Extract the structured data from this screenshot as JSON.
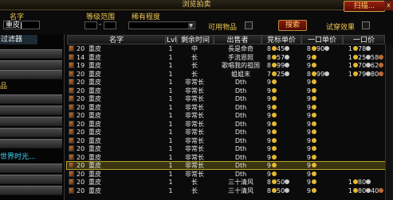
{
  "window": {
    "title": "浏览拍卖",
    "scan_button": "扫描...",
    "close": "x"
  },
  "search": {
    "name_label": "名字",
    "name_value": "重皮",
    "level_range_label": "等级范围",
    "level_sep": "-",
    "rarity_label": "稀有程度",
    "usable_label": "可用物品",
    "search_button": "搜索",
    "preview_label": "试穿效果"
  },
  "left_panel": {
    "filter_tab": "过滤器",
    "highlight_item": "品",
    "cyan_text": "世界时光..."
  },
  "columns": {
    "name": "名字",
    "lvl": "Lvl",
    "time_left": "剩余时间",
    "seller": "出售者",
    "bid_per": "竞标单价",
    "buyout_per": "一口单价",
    "buyout": "一口价"
  },
  "rows": [
    {
      "cnt": "20",
      "name": "重皮",
      "lvl": "1",
      "time": "中",
      "seller": "長是命奇",
      "bid": [
        "8",
        "45",
        ""
      ],
      "bo": [
        "8",
        "90",
        ""
      ],
      "price": [
        "1",
        "78",
        ""
      ]
    },
    {
      "cnt": "14",
      "name": "重皮",
      "lvl": "1",
      "time": "长",
      "seller": "手流恩照",
      "bid": [
        "8",
        "57",
        ""
      ],
      "bo": [
        "9",
        "",
        ""
      ],
      "price": [
        "1",
        "25",
        "58"
      ]
    },
    {
      "cnt": "19",
      "name": "重皮",
      "lvl": "1",
      "time": "长",
      "seller": "歌唱我的祖国",
      "bid": [
        "8",
        "99",
        ""
      ],
      "bo": [
        "9",
        "",
        ""
      ],
      "price": [
        "1",
        "70",
        "62"
      ]
    },
    {
      "cnt": "20",
      "name": "重皮",
      "lvl": "1",
      "time": "长",
      "seller": "姐姐末",
      "bid": [
        "7",
        "25",
        ""
      ],
      "bo": [
        "8",
        "99",
        ""
      ],
      "price": [
        "1",
        "79",
        "80"
      ]
    },
    {
      "cnt": "20",
      "name": "重皮",
      "lvl": "1",
      "time": "非常长",
      "seller": "Dth",
      "bid": [
        "9",
        "",
        ""
      ],
      "bo": [
        "9",
        "",
        ""
      ],
      "price": [
        "",
        "",
        ""
      ]
    },
    {
      "cnt": "20",
      "name": "重皮",
      "lvl": "1",
      "time": "非常长",
      "seller": "Dth",
      "bid": [
        "9",
        "",
        ""
      ],
      "bo": [
        "9",
        "",
        ""
      ],
      "price": [
        "",
        "",
        ""
      ]
    },
    {
      "cnt": "20",
      "name": "重皮",
      "lvl": "1",
      "time": "非常长",
      "seller": "Dth",
      "bid": [
        "9",
        "",
        ""
      ],
      "bo": [
        "9",
        "",
        ""
      ],
      "price": [
        "",
        "",
        ""
      ]
    },
    {
      "cnt": "20",
      "name": "重皮",
      "lvl": "1",
      "time": "非常长",
      "seller": "Dth",
      "bid": [
        "9",
        "",
        ""
      ],
      "bo": [
        "9",
        "",
        ""
      ],
      "price": [
        "",
        "",
        ""
      ]
    },
    {
      "cnt": "20",
      "name": "重皮",
      "lvl": "1",
      "time": "非常长",
      "seller": "Dth",
      "bid": [
        "9",
        "",
        ""
      ],
      "bo": [
        "9",
        "",
        ""
      ],
      "price": [
        "",
        "",
        ""
      ]
    },
    {
      "cnt": "20",
      "name": "重皮",
      "lvl": "1",
      "time": "非常长",
      "seller": "Dth",
      "bid": [
        "9",
        "",
        ""
      ],
      "bo": [
        "9",
        "",
        ""
      ],
      "price": [
        "",
        "",
        ""
      ]
    },
    {
      "cnt": "20",
      "name": "重皮",
      "lvl": "1",
      "time": "非常长",
      "seller": "Dth",
      "bid": [
        "9",
        "",
        ""
      ],
      "bo": [
        "9",
        "",
        ""
      ],
      "price": [
        "",
        "",
        ""
      ]
    },
    {
      "cnt": "20",
      "name": "重皮",
      "lvl": "1",
      "time": "非常长",
      "seller": "Dth",
      "bid": [
        "9",
        "",
        ""
      ],
      "bo": [
        "9",
        "",
        ""
      ],
      "price": [
        "",
        "",
        ""
      ]
    },
    {
      "cnt": "20",
      "name": "重皮",
      "lvl": "1",
      "time": "非常长",
      "seller": "Dth",
      "bid": [
        "9",
        "",
        ""
      ],
      "bo": [
        "9",
        "",
        ""
      ],
      "price": [
        "",
        "",
        ""
      ]
    },
    {
      "cnt": "20",
      "name": "重皮",
      "lvl": "1",
      "time": "非常长",
      "seller": "Dth",
      "bid": [
        "9",
        "",
        ""
      ],
      "bo": [
        "9",
        "",
        ""
      ],
      "price": [
        "",
        "",
        ""
      ]
    },
    {
      "cnt": "20",
      "name": "重皮",
      "lvl": "1",
      "time": "非常长",
      "seller": "Dth",
      "bid": [
        "9",
        "",
        ""
      ],
      "bo": [
        "9",
        "",
        ""
      ],
      "price": [
        "",
        "",
        ""
      ],
      "selected": true
    },
    {
      "cnt": "20",
      "name": "重皮",
      "lvl": "1",
      "time": "非常长",
      "seller": "Dth",
      "bid": [
        "9",
        "",
        ""
      ],
      "bo": [
        "9",
        "",
        ""
      ],
      "price": [
        "",
        "",
        ""
      ]
    },
    {
      "cnt": "20",
      "name": "重皮",
      "lvl": "1",
      "time": "长",
      "seller": "三十清风",
      "bid": [
        "8",
        "50",
        ""
      ],
      "bo": [
        "9",
        "",
        ""
      ],
      "price": [
        "1",
        "80",
        ""
      ]
    },
    {
      "cnt": "20",
      "name": "重皮",
      "lvl": "1",
      "time": "长",
      "seller": "三十清风",
      "bid": [
        "8",
        "50",
        ""
      ],
      "bo": [
        "9",
        "",
        ""
      ],
      "price": [
        "1",
        "80",
        "40"
      ]
    }
  ]
}
